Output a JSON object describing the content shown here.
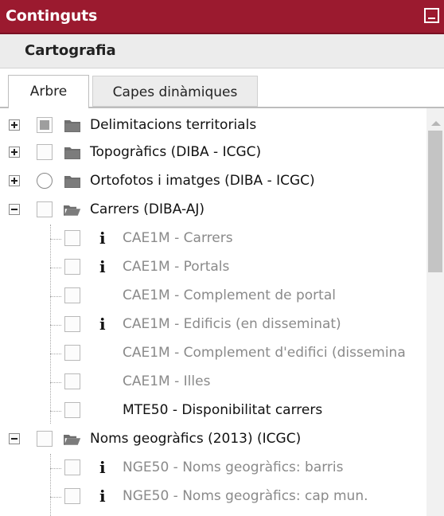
{
  "panel": {
    "title": "Continguts",
    "subtitle": "Cartografia",
    "minimize_icon": "minimize-icon",
    "accent_color": "#9b1a2f"
  },
  "tabs": [
    {
      "label": "Arbre",
      "active": true
    },
    {
      "label": "Capes dinàmiques",
      "active": false
    }
  ],
  "tree": {
    "folders": [
      {
        "label": "Delimitacions territorials",
        "expanded": false,
        "check": "partial"
      },
      {
        "label": "Topogràfics (DIBA - ICGC)",
        "expanded": false,
        "check": "unchecked"
      },
      {
        "label": "Ortofotos i imatges (DIBA - ICGC)",
        "expanded": false,
        "check": "radio"
      },
      {
        "label": "Carrers (DIBA-AJ)",
        "expanded": true,
        "check": "unchecked"
      },
      {
        "label": "Noms geogràfics (2013) (ICGC)",
        "expanded": true,
        "check": "unchecked"
      }
    ],
    "carrers_layers": [
      {
        "label": "CAE1M - Carrers",
        "info": true,
        "enabled": false
      },
      {
        "label": "CAE1M - Portals",
        "info": true,
        "enabled": false
      },
      {
        "label": "CAE1M - Complement de portal",
        "info": false,
        "enabled": false
      },
      {
        "label": "CAE1M - Edificis (en disseminat)",
        "info": true,
        "enabled": false
      },
      {
        "label": "CAE1M - Complement d'edifici (dissemina",
        "info": false,
        "enabled": false
      },
      {
        "label": "CAE1M - Illes",
        "info": false,
        "enabled": false
      },
      {
        "label": "MTE50 - Disponibilitat carrers",
        "info": false,
        "enabled": true
      }
    ],
    "noms_layers": [
      {
        "label": "NGE50 - Noms geogràfics: barris",
        "info": true,
        "enabled": false
      },
      {
        "label": "NGE50 - Noms geogràfics: cap mun.",
        "info": true,
        "enabled": false
      }
    ],
    "info_glyph": "i"
  }
}
